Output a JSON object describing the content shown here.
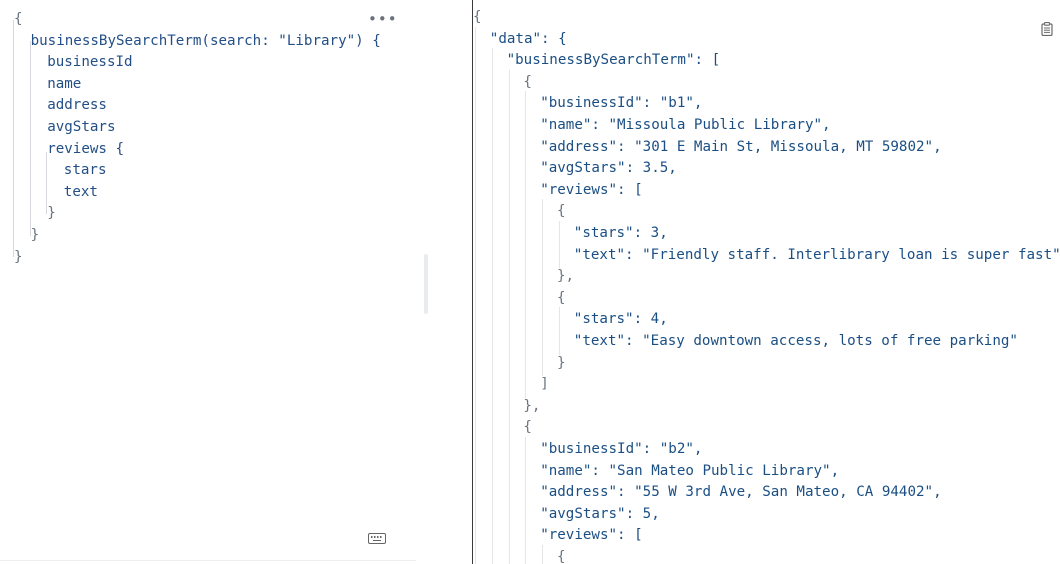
{
  "editor": {
    "more_label": "•••",
    "query_lines": [
      {
        "indent": 0,
        "text": "{"
      },
      {
        "indent": 1,
        "text": "businessBySearchTerm(search: \"Library\") {"
      },
      {
        "indent": 2,
        "text": "businessId"
      },
      {
        "indent": 2,
        "text": "name"
      },
      {
        "indent": 2,
        "text": "address"
      },
      {
        "indent": 2,
        "text": "avgStars"
      },
      {
        "indent": 2,
        "text": "reviews {"
      },
      {
        "indent": 3,
        "text": "stars"
      },
      {
        "indent": 3,
        "text": "text"
      },
      {
        "indent": 2,
        "text": "}"
      },
      {
        "indent": 1,
        "text": "}"
      },
      {
        "indent": 0,
        "text": "}"
      }
    ]
  },
  "result": {
    "lines": [
      {
        "indent": 0,
        "text": "{"
      },
      {
        "indent": 1,
        "text": "\"data\": {"
      },
      {
        "indent": 2,
        "text": "\"businessBySearchTerm\": ["
      },
      {
        "indent": 3,
        "text": "{"
      },
      {
        "indent": 4,
        "text": "\"businessId\": \"b1\","
      },
      {
        "indent": 4,
        "text": "\"name\": \"Missoula Public Library\","
      },
      {
        "indent": 4,
        "text": "\"address\": \"301 E Main St, Missoula, MT 59802\","
      },
      {
        "indent": 4,
        "text": "\"avgStars\": 3.5,"
      },
      {
        "indent": 4,
        "text": "\"reviews\": ["
      },
      {
        "indent": 5,
        "text": "{"
      },
      {
        "indent": 6,
        "text": "\"stars\": 3,"
      },
      {
        "indent": 6,
        "text": "\"text\": \"Friendly staff. Interlibrary loan is super fast\""
      },
      {
        "indent": 5,
        "text": "},"
      },
      {
        "indent": 5,
        "text": "{"
      },
      {
        "indent": 6,
        "text": "\"stars\": 4,"
      },
      {
        "indent": 6,
        "text": "\"text\": \"Easy downtown access, lots of free parking\""
      },
      {
        "indent": 5,
        "text": "}"
      },
      {
        "indent": 4,
        "text": "]"
      },
      {
        "indent": 3,
        "text": "},"
      },
      {
        "indent": 3,
        "text": "{"
      },
      {
        "indent": 4,
        "text": "\"businessId\": \"b2\","
      },
      {
        "indent": 4,
        "text": "\"name\": \"San Mateo Public Library\","
      },
      {
        "indent": 4,
        "text": "\"address\": \"55 W 3rd Ave, San Mateo, CA 94402\","
      },
      {
        "indent": 4,
        "text": "\"avgStars\": 5,"
      },
      {
        "indent": 4,
        "text": "\"reviews\": ["
      },
      {
        "indent": 5,
        "text": "{"
      }
    ]
  },
  "icons": {
    "copy": "clipboard-icon",
    "keyboard": "keyboard-shortcuts-icon",
    "more": "more-options-icon"
  },
  "colors": {
    "code_text": "#1b4f84",
    "punctuation": "#6b7580",
    "guide": "#d5d8dc"
  }
}
